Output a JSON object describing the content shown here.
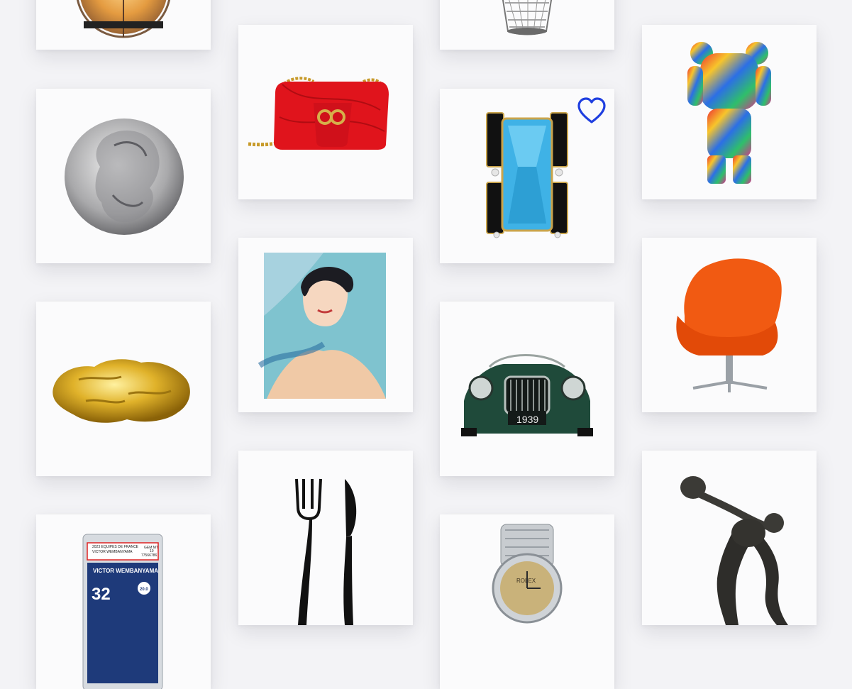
{
  "colors": {
    "background": "#f3f3f6",
    "card": "#fbfbfc",
    "favorite_outline": "#1f3fe0"
  },
  "gallery": {
    "items": [
      {
        "name": "globe-lamp"
      },
      {
        "name": "silver-coin"
      },
      {
        "name": "gold-nugget"
      },
      {
        "name": "graded-trading-card",
        "card_text": {
          "header": "2023 EQUIPES DE FRANCE",
          "player_small": "VICTOR WEMBANYAMA",
          "grade": "GEM MT",
          "grade_num": "10",
          "cert": "77566786",
          "player": "VICTOR WEMBANYAMA",
          "number": "32",
          "rating": "20.0"
        }
      },
      {
        "name": "red-quilted-handbag"
      },
      {
        "name": "portrait-painting"
      },
      {
        "name": "fork-and-knife-sculpture"
      },
      {
        "name": "wire-stool"
      },
      {
        "name": "aquamarine-brooch",
        "favorite": true
      },
      {
        "name": "vintage-sports-car",
        "plate": "1939"
      },
      {
        "name": "rolex-watch",
        "dial_text": "ROLEX"
      },
      {
        "name": "graffiti-bear-figure"
      },
      {
        "name": "orange-egg-chair"
      },
      {
        "name": "discobolus-statue"
      }
    ]
  }
}
